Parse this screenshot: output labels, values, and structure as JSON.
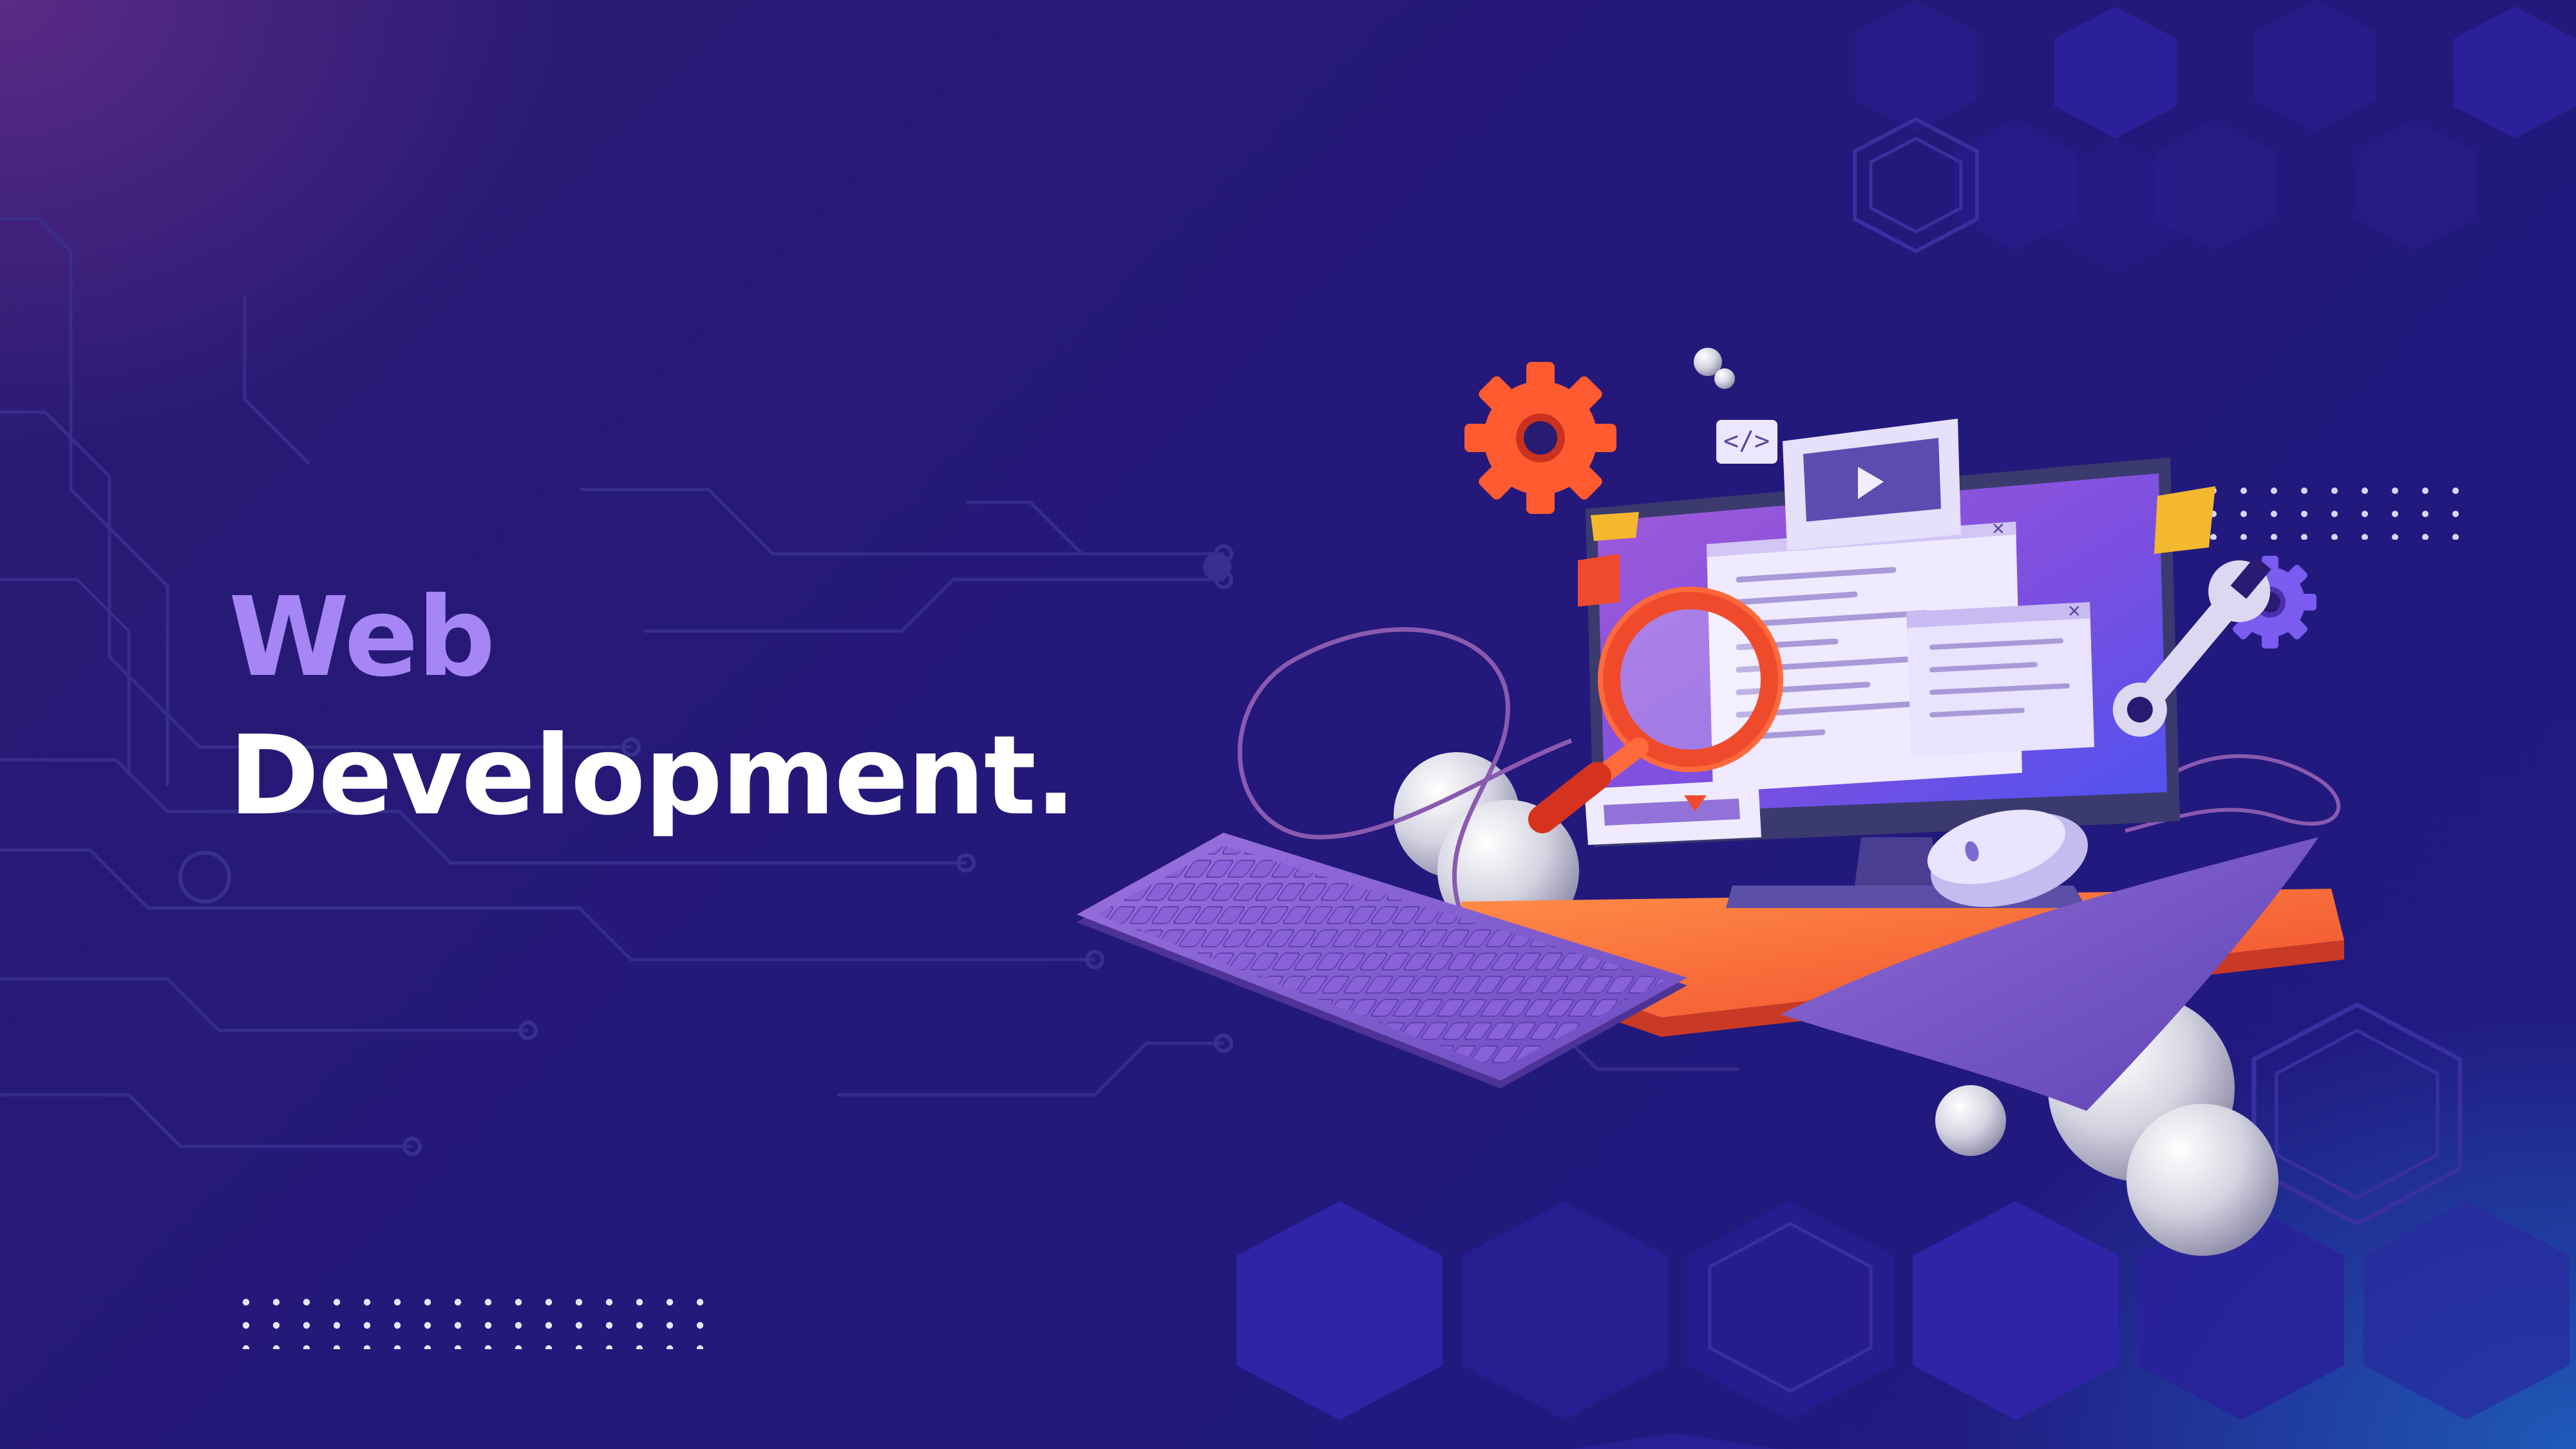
{
  "hero": {
    "title_line_1": "Web",
    "title_line_2": "Development."
  },
  "colors": {
    "background": "#231a73",
    "accent_purple": "#a586f4",
    "title_white": "#ffffff",
    "orange": "#ff6a3d",
    "red_orange": "#f0462f"
  },
  "icons": [
    "circuit-lines-decoration",
    "hexagon-pattern-decoration",
    "dot-grid-decoration",
    "gear-icon",
    "code-tag-icon",
    "play-icon",
    "close-icon",
    "magnifying-glass-icon",
    "wrench-icon",
    "monitor-illustration",
    "keyboard-illustration",
    "mouse-illustration"
  ]
}
